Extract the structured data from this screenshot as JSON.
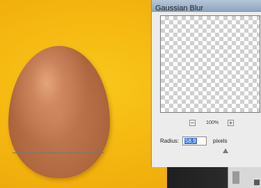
{
  "dialog": {
    "title": "Gaussian Blur",
    "zoom": {
      "level": "100%",
      "minus_label": "−",
      "plus_label": "+"
    },
    "radius": {
      "label": "Radius:",
      "value": "58,9",
      "unit": "pixels",
      "slider_fraction": 0.8
    }
  },
  "colors": {
    "canvas_background": "#f4b40f",
    "egg": "#b06840",
    "selection": "#3875d7"
  }
}
